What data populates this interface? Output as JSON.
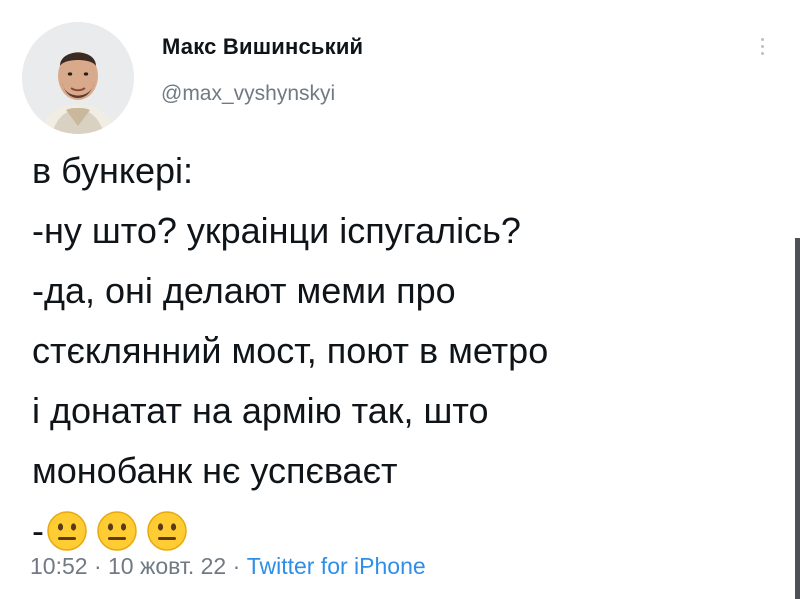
{
  "tweet": {
    "author": {
      "display_name": "Макс Вишинський",
      "handle": "@max_vyshynskyi",
      "avatar_icon": "profile-photo"
    },
    "menu_icon": "more-vertical-icon",
    "lines": [
      "в бункері:",
      "-ну што? украінци іспугаліcь?",
      "-да, оні делают меми про",
      "стєклянний мост, поют в метро",
      "і донатат на армію так, што",
      "монобанк нє успєваєт"
    ],
    "last_line_prefix": "-",
    "emojis": [
      "neutral-face-emoji",
      "neutral-face-emoji",
      "neutral-face-emoji"
    ],
    "meta": {
      "time": "10:52",
      "separator_1": "·",
      "date": "10 жовт. 22",
      "separator_2": "·",
      "source": "Twitter for iPhone"
    }
  },
  "colors": {
    "text": "#0f1419",
    "secondary": "#6f7a84",
    "link": "#2f8fe6",
    "emoji_yellow": "#ffcc33"
  }
}
